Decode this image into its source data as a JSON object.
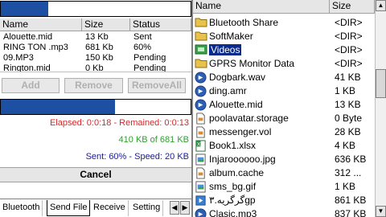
{
  "left_panel": {
    "top_progress": 0.25,
    "queue_columns": [
      "Name",
      "Size",
      "Status"
    ],
    "queue": [
      {
        "name": "Alouette.mid",
        "size": "13 Kb",
        "status": "Sent"
      },
      {
        "name": "RING TON .mp3",
        "size": "681 Kb",
        "status": "60%"
      },
      {
        "name": "09.MP3",
        "size": "150 Kb",
        "status": "Pending"
      },
      {
        "name": "Rington.mid",
        "size": "0 Kb",
        "status": "Pending"
      }
    ],
    "buttons": {
      "add": "Add",
      "remove": "Remove",
      "remove_all": "RemoveAll"
    },
    "transfer_progress": 0.6,
    "status": {
      "elapsed": "Elapsed: 0:0:18 - Remained: 0:0:13",
      "bytes": "410 KB of 681 KB",
      "sent_speed": "Sent: 60% - Speed: 20 KB"
    },
    "cancel_label": "Cancel",
    "tabs": [
      "Bluetooth",
      "Send File",
      "Receive",
      "Setting"
    ],
    "active_tab": "Send File"
  },
  "right_panel": {
    "columns": [
      "Name",
      "Size"
    ],
    "files": [
      {
        "name": "Bluetooth Share",
        "size": "<DIR>",
        "icon": "folder-icon"
      },
      {
        "name": "SoftMaker",
        "size": "<DIR>",
        "icon": "folder-icon"
      },
      {
        "name": "Videos",
        "size": "<DIR>",
        "icon": "video-folder-icon",
        "selected": true
      },
      {
        "name": "GPRS Monitor Data",
        "size": "<DIR>",
        "icon": "folder-icon"
      },
      {
        "name": "Dogbark.wav",
        "size": "41 KB",
        "icon": "audio-file-icon"
      },
      {
        "name": "ding.amr",
        "size": "1 KB",
        "icon": "audio-file-icon"
      },
      {
        "name": "Alouette.mid",
        "size": "13 KB",
        "icon": "audio-file-icon"
      },
      {
        "name": "poolavatar.storage",
        "size": "0 Byte",
        "icon": "generic-file-icon"
      },
      {
        "name": "messenger.vol",
        "size": "28 KB",
        "icon": "generic-file-icon"
      },
      {
        "name": "Book1.xlsx",
        "size": "4 KB",
        "icon": "spreadsheet-file-icon"
      },
      {
        "name": "Injaroooooo.jpg",
        "size": "636 KB",
        "icon": "image-file-icon"
      },
      {
        "name": "album.cache",
        "size": "312 ...",
        "icon": "generic-file-icon"
      },
      {
        "name": "sms_bg.gif",
        "size": "1 KB",
        "icon": "image-file-icon"
      },
      {
        "name": "گرگریه.۳gp",
        "size": "861 KB",
        "icon": "video-file-icon"
      },
      {
        "name": "Clasic.mp3",
        "size": "837 KB",
        "icon": "audio-file-icon"
      }
    ]
  },
  "scrollbar": {
    "up": "▲",
    "down": "▼",
    "thumb_position": 0.35
  },
  "colors": {
    "progress": "#1d4fa2",
    "selection": "#0a2b8c",
    "elapsed_text": "#d42a2a",
    "bytes_text": "#2ca02c",
    "sent_text": "#1a1a9a",
    "folder": "#e8c24a"
  }
}
